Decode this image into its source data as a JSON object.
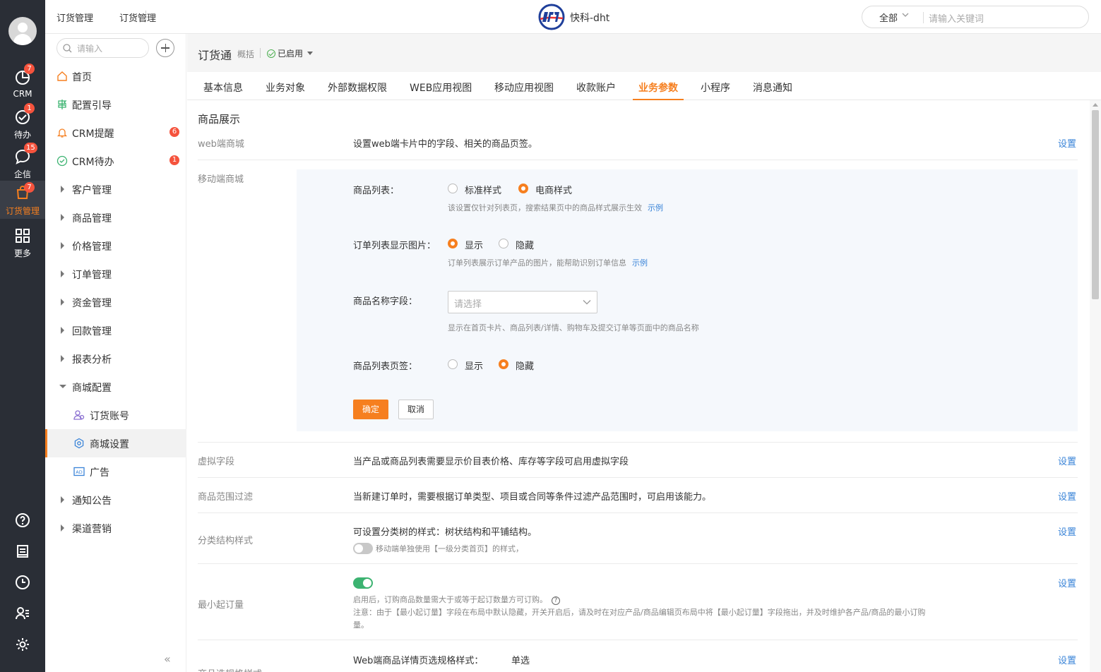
{
  "rail": {
    "items": [
      {
        "label": "CRM",
        "badge": "7"
      },
      {
        "label": "待办",
        "badge": "1"
      },
      {
        "label": "企信",
        "badge": "15"
      },
      {
        "label": "订货管理",
        "badge": "7"
      },
      {
        "label": "更多",
        "badge": ""
      }
    ]
  },
  "topbar": {
    "crumb1": "订货管理",
    "crumb2": "订货管理",
    "brand": "快科-dht",
    "search_scope": "全部",
    "search_placeholder": "请输入关键词"
  },
  "sidebar": {
    "search_placeholder": "请输入",
    "items": [
      {
        "label": "首页"
      },
      {
        "label": "配置引导"
      },
      {
        "label": "CRM提醒",
        "badge": "6"
      },
      {
        "label": "CRM待办",
        "badge": "1"
      },
      {
        "label": "客户管理"
      },
      {
        "label": "商品管理"
      },
      {
        "label": "价格管理"
      },
      {
        "label": "订单管理"
      },
      {
        "label": "资金管理"
      },
      {
        "label": "回款管理"
      },
      {
        "label": "报表分析"
      },
      {
        "label": "商城配置"
      },
      {
        "label": "订货账号"
      },
      {
        "label": "商城设置"
      },
      {
        "label": "广告"
      },
      {
        "label": "通知公告"
      },
      {
        "label": "渠道营销"
      }
    ],
    "collapse": "«"
  },
  "app": {
    "title": "订货通",
    "overview": "概括",
    "status": "已启用"
  },
  "tabs": [
    "基本信息",
    "业务对象",
    "外部数据权限",
    "WEB应用视图",
    "移动应用视图",
    "收款账户",
    "业务参数",
    "小程序",
    "消息通知"
  ],
  "active_tab": "业务参数",
  "section": {
    "title": "商品展示",
    "set_label": "设置",
    "web_mall": {
      "label": "web端商城",
      "desc": "设置web端卡片中的字段、相关的商品页签。"
    },
    "mobile_mall": {
      "label": "移动端商城",
      "list_style": {
        "label": "商品列表：",
        "opt1": "标准样式",
        "opt2": "电商样式",
        "selected": "电商样式",
        "hint": "该设置仅针对列表页，搜索结果页中的商品样式展示生效",
        "link": "示例"
      },
      "order_image": {
        "label": "订单列表显示图片：",
        "opt1": "显示",
        "opt2": "隐藏",
        "selected": "显示",
        "hint": "订单列表展示订单产品的图片，能帮助识别订单信息",
        "link": "示例"
      },
      "name_field": {
        "label": "商品名称字段：",
        "placeholder": "请选择",
        "hint": "显示在首页卡片、商品列表/详情、购物车及提交订单等页面中的商品名称"
      },
      "list_tab": {
        "label": "商品列表页签：",
        "opt1": "显示",
        "opt2": "隐藏",
        "selected": "隐藏"
      },
      "ok": "确定",
      "cancel": "取消"
    },
    "virtual": {
      "label": "虚拟字段",
      "desc": "当产品或商品列表需要显示价目表价格、库存等字段可启用虚拟字段"
    },
    "range_filter": {
      "label": "商品范围过滤",
      "desc": "当新建订单时，需要根据订单类型、项目或合同等条件过滤产品范围时，可启用该能力。"
    },
    "category": {
      "label": "分类结构样式",
      "desc": "可设置分类树的样式：树状结构和平铺结构。",
      "toggle_on": false,
      "toggle_text": "移动端单独使用【一级分类首页】的样式，"
    },
    "min_order": {
      "label": "最小起订量",
      "toggle_on": true,
      "desc1": "启用后，订购商品数量需大于或等于起订数量方可订购。",
      "help": "?",
      "desc2": "注意：由于【最小起订量】字段在布局中默认隐藏，开关开启后，请及时在对应产品/商品编辑页布局中将【最小起订量】字段拖出，并及时维护各产品/商品的最小订购",
      "desc3": "量。"
    },
    "spec_style": {
      "label": "商品选规格样式",
      "desc": "Web端商品详情页选规格样式：",
      "value": "单选"
    }
  }
}
